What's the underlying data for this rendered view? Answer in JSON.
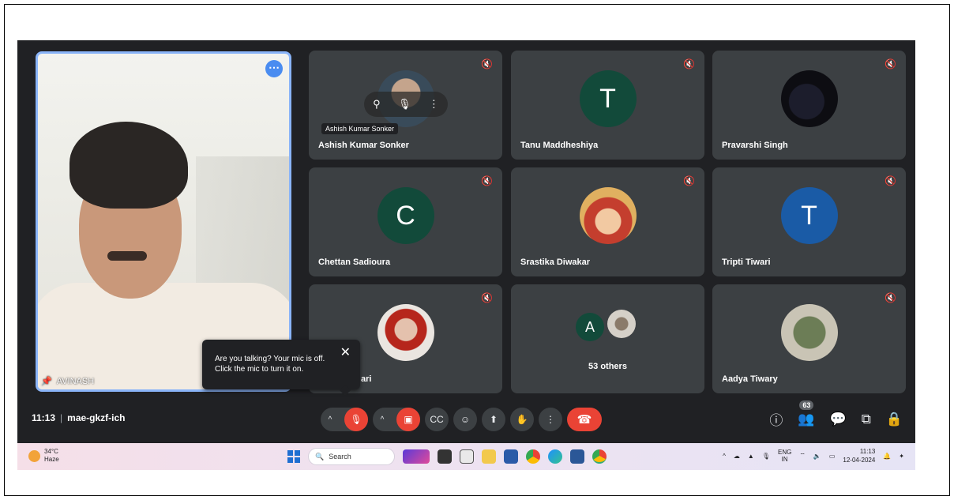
{
  "self_view": {
    "name": "AVINASH",
    "more_icon": "more-horizontal-icon"
  },
  "tiles": [
    {
      "name": "Ashish Kumar Sonker",
      "avatar": "photo",
      "hover_tag": "Ashish Kumar Sonker",
      "muted": true
    },
    {
      "name": "Tanu Maddheshiya",
      "avatar": "T",
      "muted": true
    },
    {
      "name": "Pravarshi Singh",
      "avatar": "photo",
      "muted": true
    },
    {
      "name": "Chettan Sadioura",
      "avatar": "C",
      "muted": true
    },
    {
      "name": "Srastika Diwakar",
      "avatar": "photo",
      "muted": true
    },
    {
      "name": "Tripti Tiwari",
      "avatar": "T",
      "muted": true
    },
    {
      "name": "ari",
      "avatar": "photo",
      "muted": true
    },
    {
      "name": "53 others",
      "avatar": "A",
      "muted": false
    },
    {
      "name": "Aadya Tiwary",
      "avatar": "photo",
      "muted": true
    }
  ],
  "toast": {
    "line1": "Are you talking? Your mic is off.",
    "line2": "Click the mic to turn it on."
  },
  "meeting": {
    "time": "11:13",
    "code": "mae-gkzf-ich"
  },
  "people_count": "63",
  "taskbar": {
    "temperature": "34°C",
    "condition": "Haze",
    "search_label": "Search",
    "language_top": "ENG",
    "language_bottom": "IN",
    "time": "11:13",
    "date": "12-04-2024"
  },
  "colors": {
    "meet_bg": "#202124",
    "tile_bg": "#3c4043",
    "red": "#ea4335",
    "accent": "#8ab4f8"
  }
}
